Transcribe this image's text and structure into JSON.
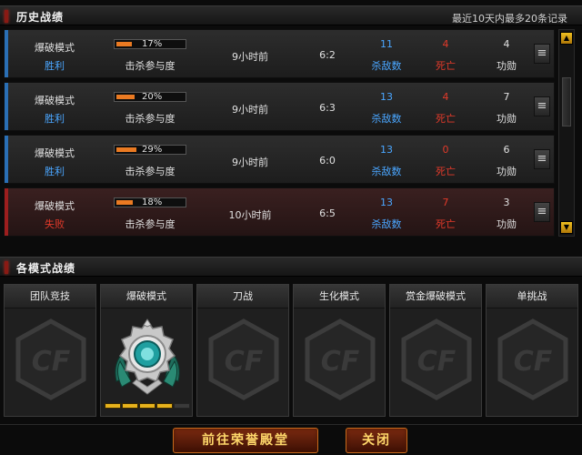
{
  "history": {
    "title": "历史战绩",
    "note": "最近10天内最多20条记录",
    "participation_label": "击杀参与度",
    "kills_label": "杀敌数",
    "deaths_label": "死亡",
    "merit_label": "功勋",
    "rows": [
      {
        "mode": "爆破模式",
        "result": "胜利",
        "participation": "17%",
        "time": "9小时前",
        "score": "6:2",
        "kills": "11",
        "deaths": "4",
        "merit": "4"
      },
      {
        "mode": "爆破模式",
        "result": "胜利",
        "participation": "20%",
        "time": "9小时前",
        "score": "6:3",
        "kills": "13",
        "deaths": "4",
        "merit": "7"
      },
      {
        "mode": "爆破模式",
        "result": "胜利",
        "participation": "29%",
        "time": "9小时前",
        "score": "6:0",
        "kills": "13",
        "deaths": "0",
        "merit": "6"
      },
      {
        "mode": "爆破模式",
        "result": "失败",
        "participation": "18%",
        "time": "10小时前",
        "score": "6:5",
        "kills": "13",
        "deaths": "7",
        "merit": "3"
      }
    ]
  },
  "modes": {
    "title": "各模式战绩",
    "cards": [
      {
        "name": "团队竞技",
        "rank": "none"
      },
      {
        "name": "爆破模式",
        "rank": "silver-medal",
        "level": 4,
        "max_level": 5
      },
      {
        "name": "刀战",
        "rank": "none"
      },
      {
        "name": "生化模式",
        "rank": "none"
      },
      {
        "name": "赏金爆破模式",
        "rank": "none"
      },
      {
        "name": "单挑战",
        "rank": "none"
      }
    ]
  },
  "buttons": {
    "goto": "前往荣誉殿堂",
    "close": "关闭"
  },
  "icons": {
    "row_menu": "list-menu-icon",
    "placeholder": "cf-logo-icon",
    "medal": "silver-rank-medal-icon",
    "scroll_up": "arrow-up-icon",
    "scroll_down": "arrow-down-icon"
  },
  "colors": {
    "win_stripe": "#2a6fb5",
    "loss_stripe": "#9d1e1e",
    "progress": "#ea7a22",
    "kills": "#4aa6ff",
    "deaths": "#e23a2a",
    "rank_pip": "#e7b21c"
  }
}
